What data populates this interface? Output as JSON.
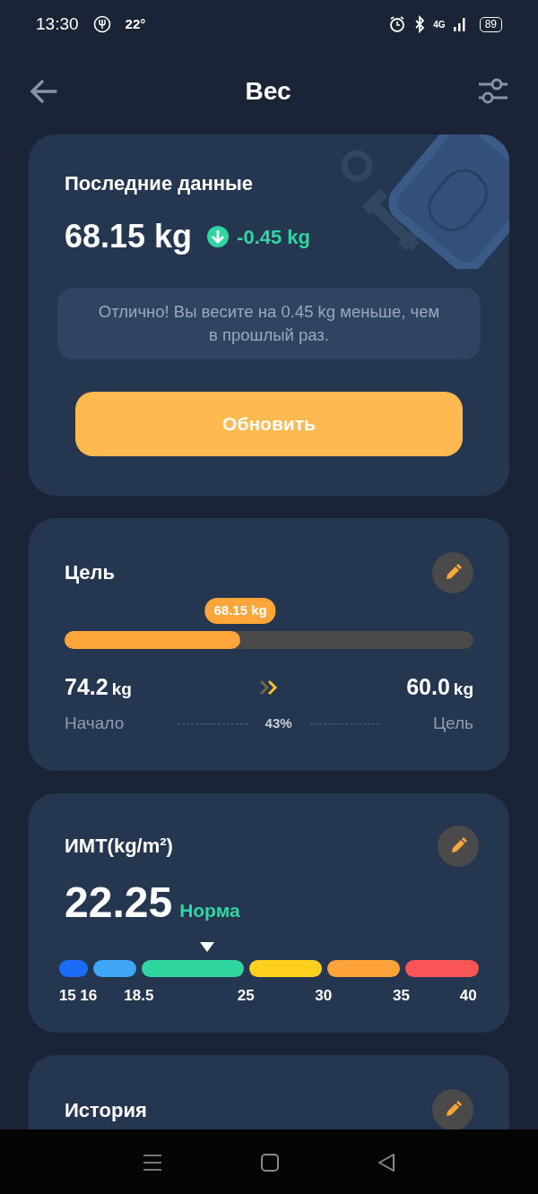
{
  "status_bar": {
    "time": "13:30",
    "temperature": "22°",
    "network": "4G",
    "battery": "89"
  },
  "header": {
    "title": "Вес"
  },
  "latest": {
    "title": "Последние данные",
    "weight": "68.15 kg",
    "change": "-0.45 kg",
    "decreased": true,
    "message": "Отлично! Вы весите на 0.45 kg меньше, чем в прошлый раз.",
    "button": "Обновить"
  },
  "goal": {
    "title": "Цель",
    "current": "68.15 kg",
    "level": 0.43,
    "start_value": "74.2",
    "start_unit": "kg",
    "target_value": "60.0",
    "target_unit": "kg",
    "start_label": "Начало",
    "percent": "43%",
    "target_label": "Цель"
  },
  "bmi": {
    "title": "ИМТ(kg/m²)",
    "value": "22.25",
    "category": "Норма",
    "segments": [
      {
        "color": "#1a6cf5"
      },
      {
        "color": "#3ea6f5"
      },
      {
        "color": "#2fd6a0"
      },
      {
        "color": "#fed11e"
      },
      {
        "color": "#fea33a"
      },
      {
        "color": "#f95556"
      }
    ],
    "ticks": [
      "15",
      "16",
      "18.5",
      "25",
      "30",
      "35",
      "40"
    ]
  },
  "history": {
    "title": "История"
  }
}
